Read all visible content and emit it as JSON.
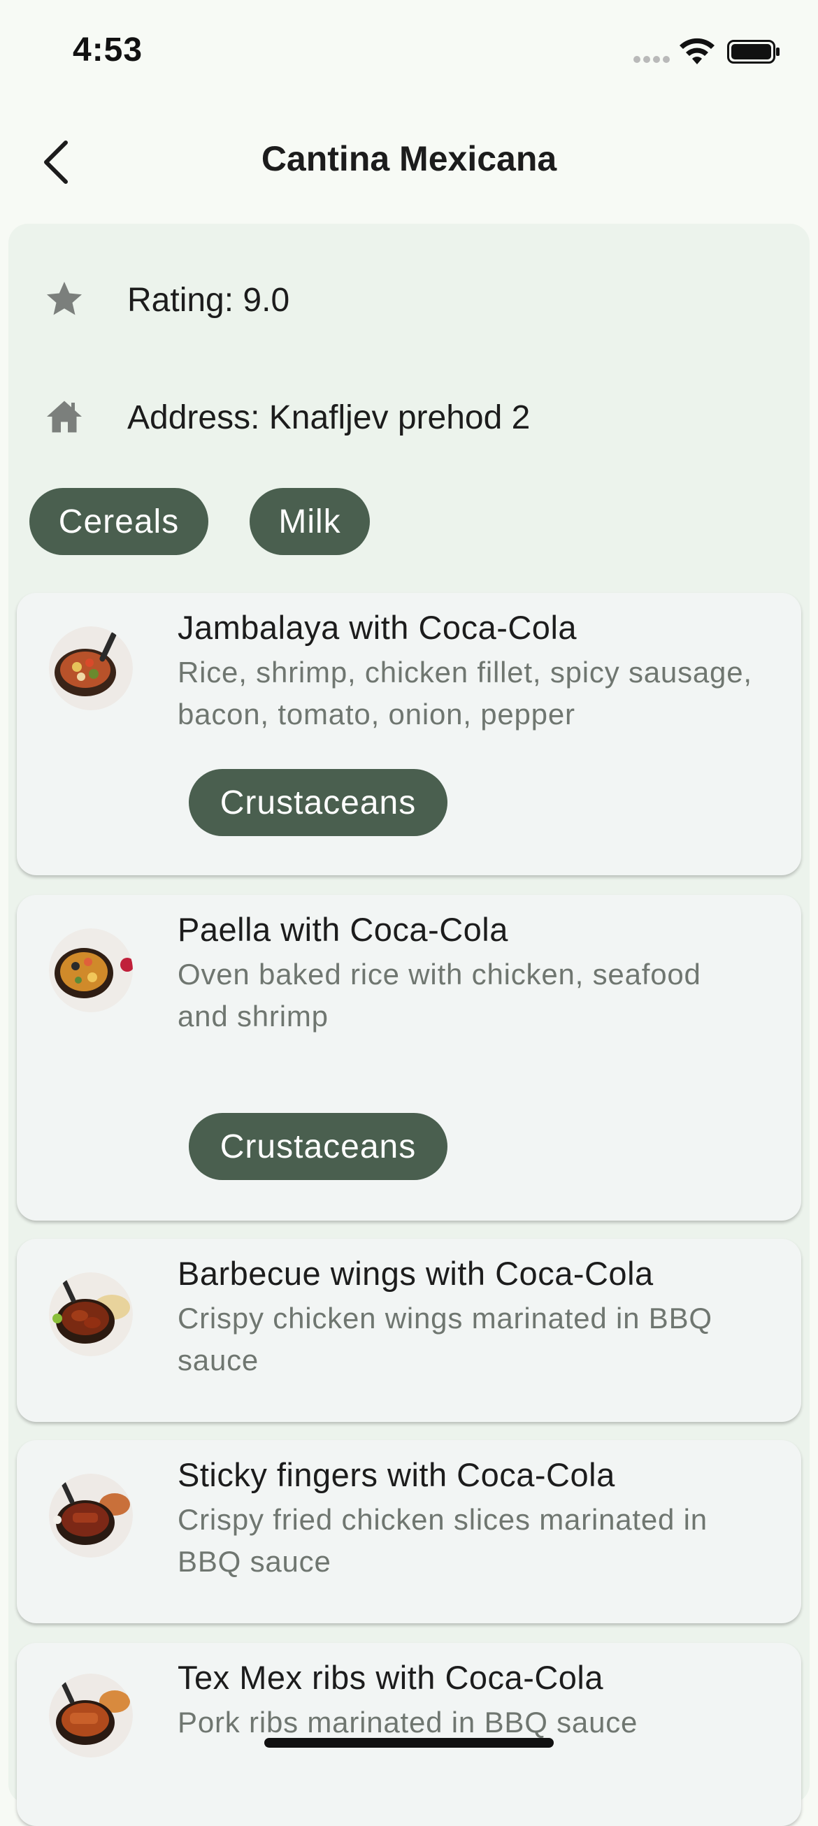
{
  "status_bar": {
    "time": "4:53"
  },
  "app_bar": {
    "title": "Cantina Mexicana",
    "back_icon": "chevron-left-icon"
  },
  "restaurant": {
    "rating": "Rating: 9.0",
    "rating_icon": "star-icon",
    "address": "Address: Knafljev prehod 2",
    "address_icon": "house-icon",
    "tags": [
      "Cereals",
      "Milk"
    ]
  },
  "dishes": [
    {
      "name": "Jambalaya with Coca-Cola",
      "description": "Rice, shrimp, chicken fillet, spicy sausage, bacon, tomato, onion, pepper",
      "allergen": "Crustaceans"
    },
    {
      "name": "Paella with Coca-Cola",
      "description": "Oven baked rice with chicken, seafood and shrimp",
      "allergen": "Crustaceans"
    },
    {
      "name": "Barbecue wings with Coca-Cola",
      "description": "Crispy chicken wings marinated in BBQ sauce"
    },
    {
      "name": "Sticky fingers with Coca-Cola",
      "description": "Crispy fried chicken slices marinated in BBQ sauce"
    },
    {
      "name": "Tex Mex ribs with Coca-Cola",
      "description": "Pork ribs marinated in BBQ sauce"
    }
  ],
  "colors": {
    "chip": "#4a5f4f",
    "panel": "#ecf3ec",
    "card": "#f2f5f4",
    "background": "#f7faf5"
  }
}
